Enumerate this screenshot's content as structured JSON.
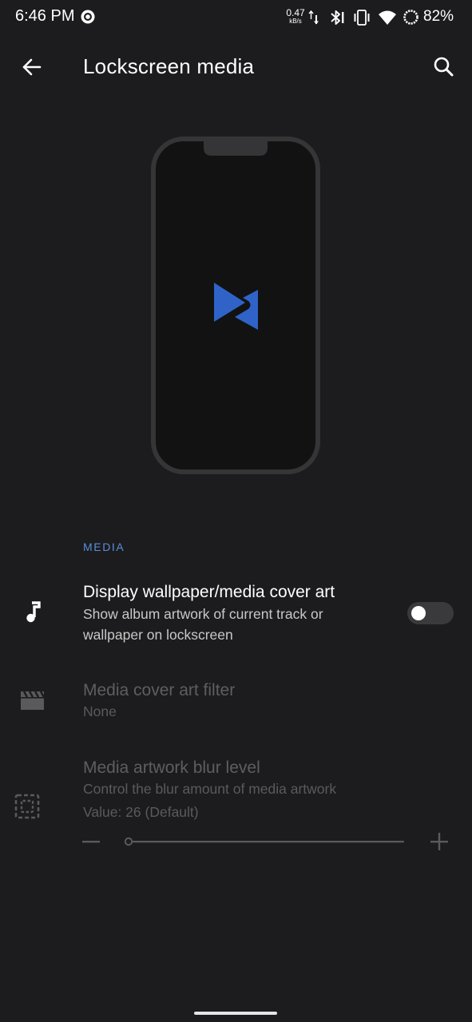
{
  "status_bar": {
    "time": "6:46 PM",
    "net_speed_value": "0.47",
    "net_speed_unit": "kB/s",
    "battery_percent": "82%",
    "icons": [
      "record-icon",
      "data-arrows-icon",
      "bluetooth-icon",
      "vibrate-icon",
      "wifi-icon",
      "battery-ring-icon"
    ]
  },
  "toolbar": {
    "title": "Lockscreen media",
    "back_icon": "arrow-back-icon",
    "search_icon": "search-icon"
  },
  "preview": {
    "logo_icon": "app-logo-icon",
    "logo_color": "#2f63c7"
  },
  "section": {
    "header": "MEDIA"
  },
  "preferences": [
    {
      "icon": "music-note-icon",
      "title": "Display wallpaper/media cover art",
      "summary_line1": "Show album artwork of current track or",
      "summary_line2": "wallpaper on lockscreen",
      "enabled": true,
      "toggle_on": false
    },
    {
      "icon": "movie-clapper-icon",
      "title": "Media cover art filter",
      "summary": "None",
      "enabled": false
    },
    {
      "icon": "blur-select-icon",
      "title": "Media artwork blur level",
      "summary": "Control the blur amount of media artwork",
      "value_text": "Value: 26  (Default)",
      "enabled": false,
      "slider_value": 26,
      "slider_fraction": 0.0
    }
  ],
  "colors": {
    "background": "#1c1c1e",
    "accent": "#5b8dd9"
  }
}
